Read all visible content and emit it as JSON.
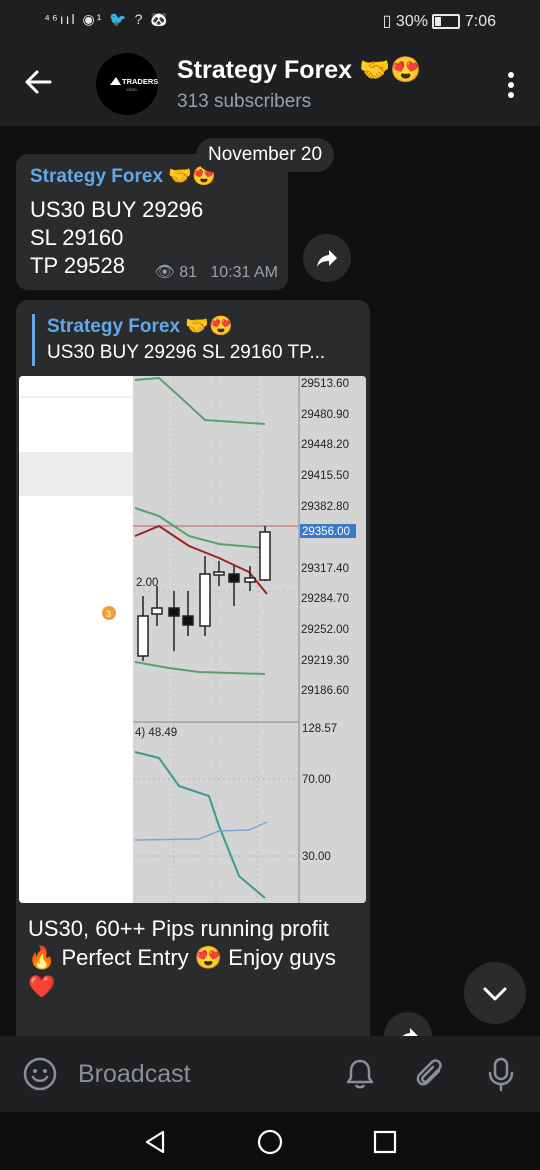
{
  "status_bar": {
    "left_icons": "⁴⁶ııl ◉¹ 🐦 ? 🐼",
    "battery": "30%",
    "time": "7:06"
  },
  "header": {
    "channel_name": "Strategy Forex 🤝😍",
    "subscribers": "313 subscribers",
    "avatar_text": "TRADERS",
    "avatar_sub": "YARD"
  },
  "chat": {
    "date_label": "November 20",
    "message1": {
      "author": "Strategy Forex 🤝😍",
      "text": "US30 BUY 29296\nSL 29160\nTP 29528",
      "views": "81",
      "time": "10:31 AM"
    },
    "message2": {
      "reply_author": "Strategy Forex 🤝😍",
      "reply_text": "US30 BUY 29296 SL 29160 TP...",
      "caption": "US30, 60++ Pips running profit 🔥 Perfect Entry 😍 Enjoy guys ❤️",
      "chart": {
        "price_labels": [
          "29513.60",
          "29480.90",
          "29448.20",
          "29415.50",
          "29382.80",
          "29356.00",
          "29317.40",
          "29284.70",
          "29252.00",
          "29219.30",
          "29186.60"
        ],
        "current_price": "29356.00",
        "left_label": "2.00",
        "indicator_label": "4) 48.49",
        "indicator_levels": [
          "128.57",
          "70.00",
          "30.00"
        ],
        "marker": "3"
      }
    }
  },
  "input": {
    "placeholder": "Broadcast"
  },
  "colors": {
    "accent": "#62a8e8",
    "bubble": "#2a2b2d",
    "background": "#101010"
  }
}
